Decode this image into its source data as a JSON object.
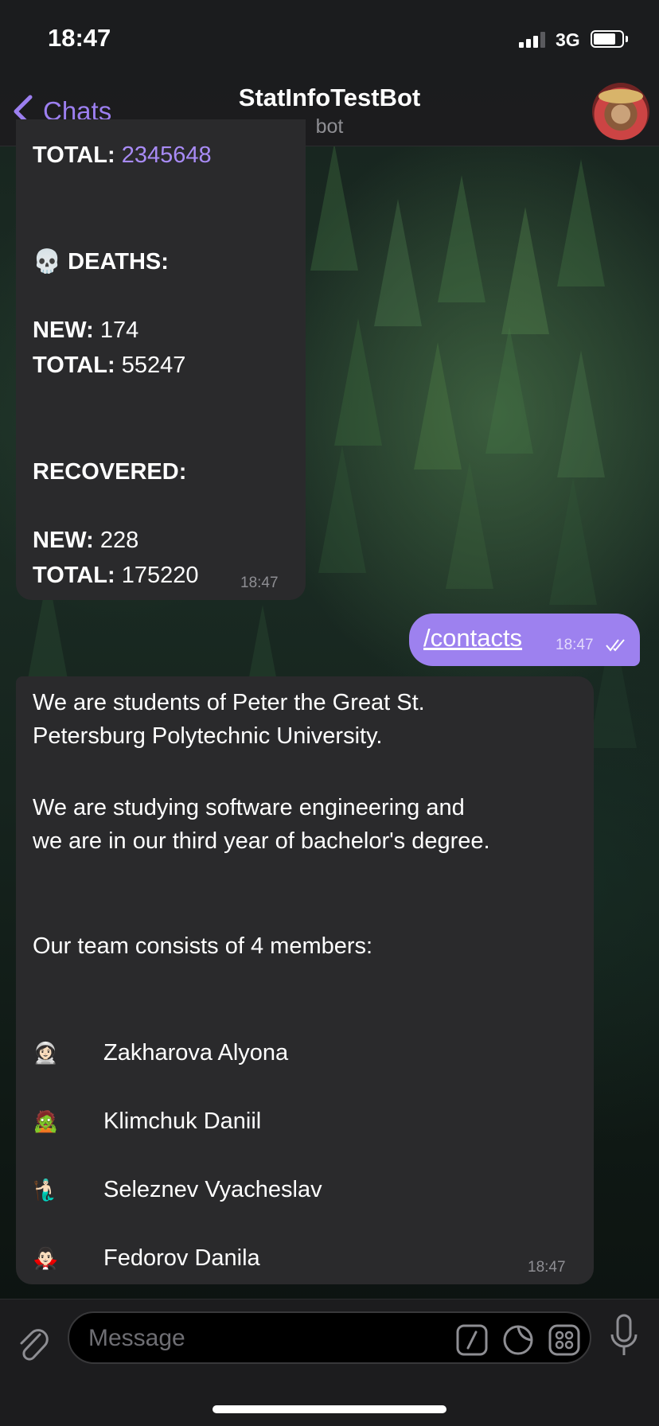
{
  "status_bar": {
    "time": "18:47",
    "network": "3G"
  },
  "nav": {
    "back_label": "Chats",
    "title": "StatInfoTestBot",
    "subtitle": "bot"
  },
  "stats_message": {
    "total_label": "TOTAL:",
    "total_value": "2345648",
    "deaths_emoji": "💀",
    "deaths_heading": "DEATHS:",
    "deaths_new_label": "NEW:",
    "deaths_new_value": "174",
    "deaths_total_label": "TOTAL:",
    "deaths_total_value": "55247",
    "recovered_heading": "RECOVERED:",
    "recovered_new_label": "NEW:",
    "recovered_new_value": "228",
    "recovered_total_label": "TOTAL:",
    "recovered_total_value": "175220",
    "time": "18:47"
  },
  "outgoing_message": {
    "text": "/contacts",
    "time": "18:47"
  },
  "contacts_message": {
    "line1": "We are students of Peter the Great St.",
    "line2": "Petersburg Polytechnic University.",
    "line3": "We are studying software engineering and",
    "line4": "we are in our third year of bachelor's degree.",
    "line5": "Our team consists of 4 members:",
    "members": [
      {
        "emoji": "👩🏻‍🚀",
        "name": "Zakharova Alyona"
      },
      {
        "emoji": "🧟",
        "name": "Klimchuk Daniil"
      },
      {
        "emoji": "🧜🏻‍♂️",
        "name": "Seleznev Vyacheslav"
      },
      {
        "emoji": "🧛🏻‍♂️",
        "name": "Fedorov Danila"
      }
    ],
    "time": "18:47"
  },
  "input": {
    "placeholder": "Message"
  },
  "colors": {
    "accent": "#9d81ef",
    "bubble_in": "#2a2a2c",
    "link": "#a88bf5"
  },
  "icons": [
    "chevron-left-icon",
    "paperclip-icon",
    "slash-command-icon",
    "sticker-icon",
    "emoji-grid-icon",
    "microphone-icon",
    "double-check-icon"
  ]
}
